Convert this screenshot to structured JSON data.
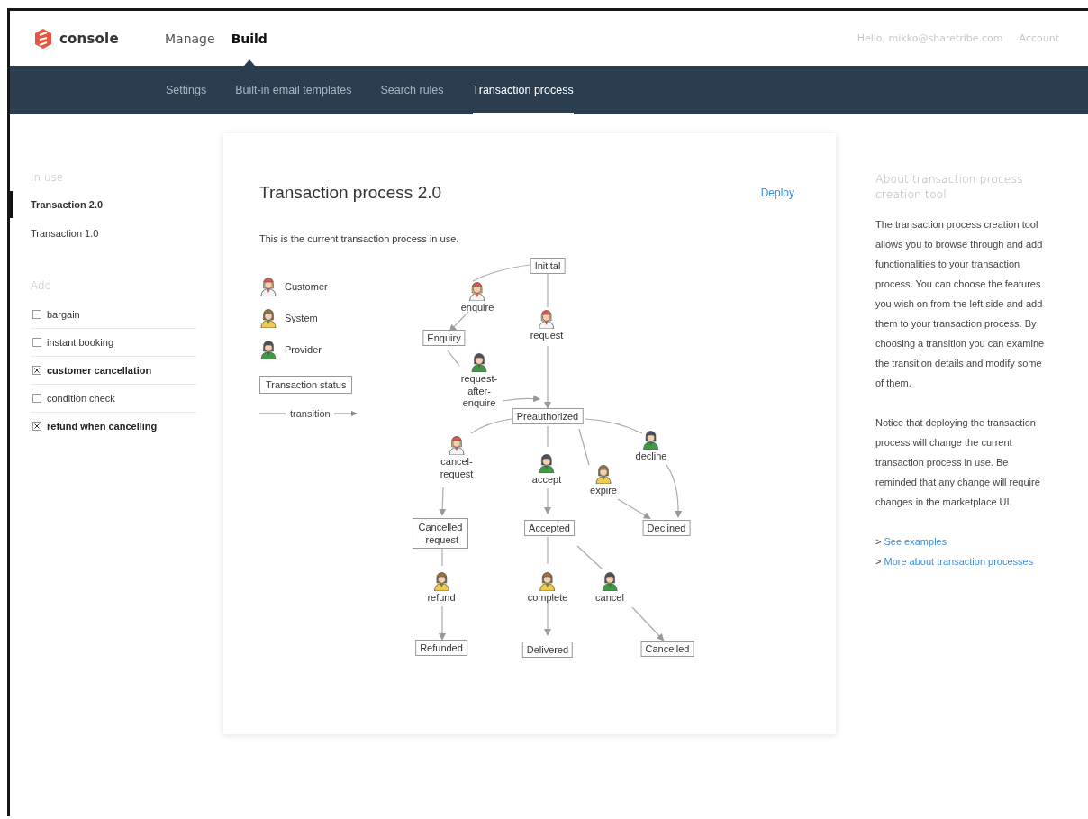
{
  "header": {
    "logo": "console",
    "nav": [
      {
        "label": "Manage",
        "selected": false
      },
      {
        "label": "Build",
        "selected": true
      }
    ],
    "greeting": "Hello, mikko@sharetribe.com",
    "account": "Account"
  },
  "subnav": [
    {
      "label": "Settings",
      "selected": false
    },
    {
      "label": "Built-in email templates",
      "selected": false
    },
    {
      "label": "Search rules",
      "selected": false
    },
    {
      "label": "Transaction process",
      "selected": true
    }
  ],
  "sidebar": {
    "in_use_heading": "In use",
    "processes": [
      {
        "label": "Transaction 2.0",
        "selected": true
      },
      {
        "label": "Transaction 1.0",
        "selected": false
      }
    ],
    "add_heading": "Add",
    "features": [
      {
        "label": "bargain",
        "checked": false
      },
      {
        "label": "instant booking",
        "checked": false
      },
      {
        "label": "customer cancellation",
        "checked": true
      },
      {
        "label": "condition check",
        "checked": false
      },
      {
        "label": "refund when cancelling",
        "checked": true
      }
    ]
  },
  "main": {
    "title": "Transaction process 2.0",
    "deploy": "Deploy",
    "description": "This is the current transaction process in use.",
    "legend": {
      "actors": [
        {
          "kind": "customer",
          "label": "Customer"
        },
        {
          "kind": "system",
          "label": "System"
        },
        {
          "kind": "provider",
          "label": "Provider"
        }
      ],
      "status_label": "Transaction status",
      "transition_label": "transition"
    },
    "diagram": {
      "states": [
        "Initital",
        "Enquiry",
        "Preauthorized",
        "Cancelled -request",
        "Accepted",
        "Declined",
        "Refunded",
        "Delivered",
        "Cancelled"
      ],
      "transitions": [
        {
          "label": "enquire",
          "kind": "customer"
        },
        {
          "label": "request",
          "kind": "customer"
        },
        {
          "label": "request-after-enquire",
          "kind": "provider"
        },
        {
          "label": "cancel-request",
          "kind": "customer"
        },
        {
          "label": "accept",
          "kind": "provider"
        },
        {
          "label": "expire",
          "kind": "system"
        },
        {
          "label": "decline",
          "kind": "provider"
        },
        {
          "label": "refund",
          "kind": "system"
        },
        {
          "label": "complete",
          "kind": "system"
        },
        {
          "label": "cancel",
          "kind": "provider"
        }
      ]
    }
  },
  "about": {
    "title": "About transaction process creation tool",
    "paragraphs": [
      "The transaction process creation tool allows you to browse through and add functionalities to your transaction process. You can choose the features you wish on from the left side and add them to your transaction process. By choosing a transition you can examine the transition details and modify some of them.",
      "Notice that deploying the transaction process will change the current transaction process in use. Be reminded that any change will require changes in the marketplace UI."
    ],
    "links": [
      {
        "prefix": ">",
        "label": "See examples"
      },
      {
        "prefix": ">",
        "label": "More about transaction processes"
      }
    ]
  }
}
